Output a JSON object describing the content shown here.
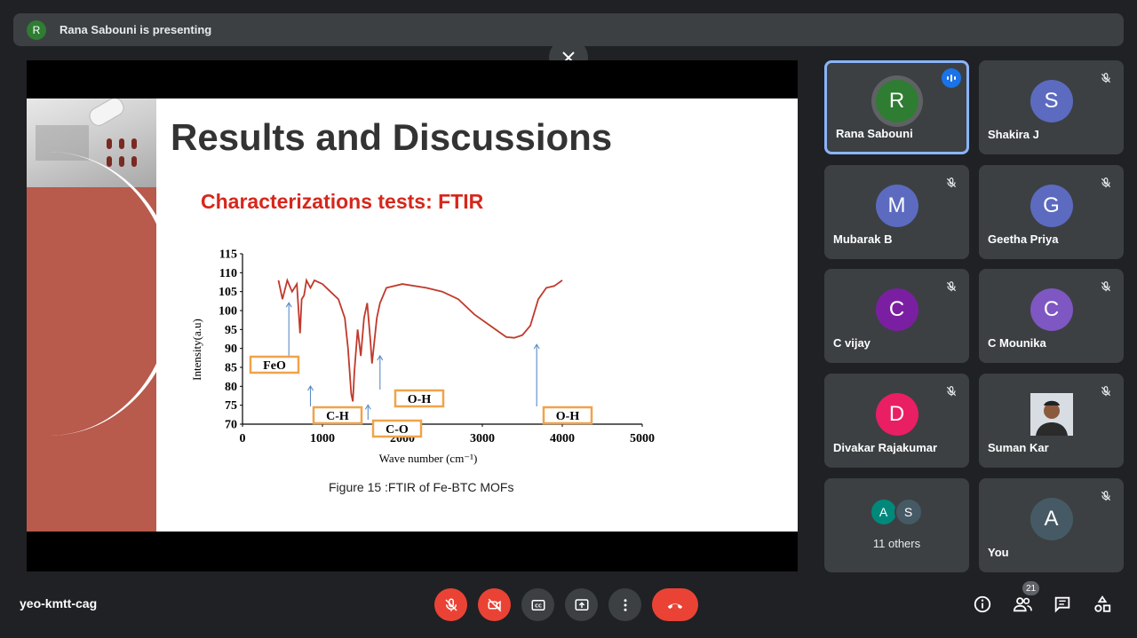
{
  "presenting": {
    "avatar_letter": "R",
    "text": "Rana Sabouni is presenting"
  },
  "slide": {
    "title": "Results and Discussions",
    "subtitle": "Characterizations tests: FTIR",
    "caption": "Figure 15 :FTIR of Fe-BTC MOFs"
  },
  "chart_data": {
    "type": "line",
    "xlabel": "Wave number (cm⁻¹)",
    "ylabel": "Intensity(a.u)",
    "xlim": [
      0,
      5000
    ],
    "ylim": [
      70,
      115
    ],
    "x_ticks": [
      "0",
      "1000",
      "2000",
      "3000",
      "4000",
      "5000"
    ],
    "y_ticks": [
      "70",
      "75",
      "80",
      "85",
      "90",
      "95",
      "100",
      "105",
      "110",
      "115"
    ],
    "color": "#c0392b",
    "x": [
      450,
      500,
      560,
      620,
      680,
      720,
      740,
      770,
      800,
      850,
      900,
      1000,
      1100,
      1200,
      1280,
      1320,
      1360,
      1380,
      1400,
      1440,
      1480,
      1520,
      1560,
      1600,
      1620,
      1640,
      1680,
      1720,
      1800,
      2000,
      2300,
      2500,
      2700,
      2900,
      3100,
      3300,
      3400,
      3500,
      3600,
      3700,
      3800,
      3900,
      4000
    ],
    "y": [
      108,
      103,
      108,
      105,
      107,
      94,
      103,
      104,
      108,
      106,
      108,
      107,
      105,
      103,
      98,
      90,
      78,
      76,
      84,
      95,
      88,
      98,
      102,
      92,
      86,
      90,
      98,
      102,
      106,
      107,
      106,
      105,
      103,
      99,
      96,
      93,
      92.8,
      93.5,
      96,
      103,
      106,
      106.5,
      108
    ],
    "annotations": [
      {
        "label": "FeO",
        "x": 580,
        "y": 103
      },
      {
        "label": "C-H",
        "x": 850,
        "y": 81
      },
      {
        "label": "C-O",
        "x": 1570,
        "y": 76
      },
      {
        "label": "O-H",
        "x": 1720,
        "y": 89
      },
      {
        "label": "O-H",
        "x": 3680,
        "y": 92
      }
    ]
  },
  "participants": [
    {
      "name": "Rana Sabouni",
      "letter": "R",
      "color": "#2e7d32"
    },
    {
      "name": "Shakira J",
      "letter": "S",
      "color": "#5c6bc0"
    },
    {
      "name": "Mubarak B",
      "letter": "M",
      "color": "#5c6bc0"
    },
    {
      "name": "Geetha Priya",
      "letter": "G",
      "color": "#5c6bc0"
    },
    {
      "name": "C vijay",
      "letter": "C",
      "color": "#7b1fa2"
    },
    {
      "name": "C Mounika",
      "letter": "C",
      "color": "#7e57c2"
    },
    {
      "name": "Divakar Rajakumar",
      "letter": "D",
      "color": "#e91e63"
    },
    {
      "name": "Suman Kar",
      "letter": "",
      "color": "#9e9e9e"
    },
    {
      "name": "You",
      "letter": "A",
      "color": "#455a64"
    }
  ],
  "others": {
    "label": "11 others",
    "letter1": "A",
    "letter2": "S",
    "color1": "#00897b",
    "color2": "#455a64"
  },
  "meeting_code": "yeo-kmtt-cag",
  "people_count": "21",
  "icons": {
    "mic": "mic-off-icon",
    "cam": "camera-off-icon",
    "cc": "captions-icon",
    "present": "present-icon",
    "more": "more-icon",
    "end": "end-call-icon",
    "info": "info-icon",
    "people": "people-icon",
    "chat": "chat-icon",
    "activities": "activities-icon"
  }
}
